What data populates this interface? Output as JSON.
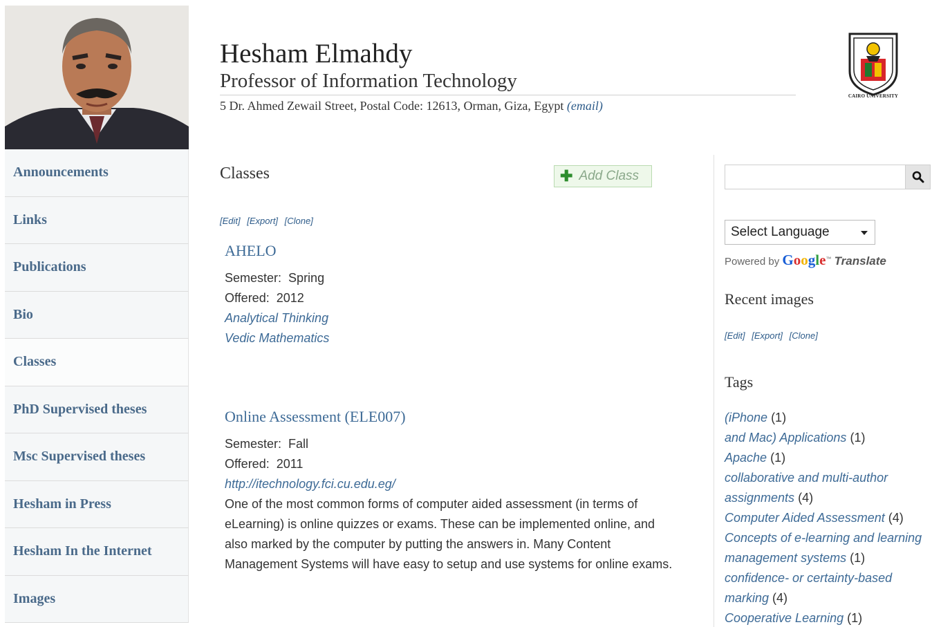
{
  "header": {
    "name": "Hesham Elmahdy",
    "title": "Professor of Information Technology",
    "address": "5 Dr. Ahmed Zewail Street, Postal Code: 12613, Orman, Giza, Egypt",
    "email_label": "(email)"
  },
  "logo": {
    "caption": "CAIRO UNIVERSITY"
  },
  "nav": {
    "items": [
      {
        "label": "Announcements"
      },
      {
        "label": "Links"
      },
      {
        "label": "Publications"
      },
      {
        "label": "Bio"
      },
      {
        "label": "Classes"
      },
      {
        "label": "PhD Supervised theses"
      },
      {
        "label": "Msc Supervised theses"
      },
      {
        "label": "Hesham in Press"
      },
      {
        "label": "Hesham In the Internet"
      },
      {
        "label": "Images"
      }
    ],
    "active_index": 4
  },
  "main": {
    "heading": "Classes",
    "add_class_label": "Add Class",
    "admin_links": {
      "edit": "[Edit]",
      "export": "[Export]",
      "clone": "[Clone]"
    },
    "classes": [
      {
        "title": "AHELO",
        "semester_label": "Semester:",
        "semester": "Spring",
        "offered_label": "Offered:",
        "offered": "2012",
        "links": [
          "Analytical Thinking",
          "Vedic Mathematics"
        ]
      },
      {
        "title": "Online Assessment (ELE007)",
        "semester_label": "Semester:",
        "semester": "Fall",
        "offered_label": "Offered:",
        "offered": "2011",
        "url": "http://itechnology.fci.cu.edu.eg/",
        "description": "One of the most common forms of computer aided assessment (in terms of eLearning) is online quizzes or exams. These can be implemented online, and also marked by the computer by putting the answers in. Many Content Management Systems will have easy to setup and use systems for online exams."
      }
    ]
  },
  "sidebar": {
    "search": {
      "value": "",
      "placeholder": ""
    },
    "language_select": {
      "selected": "Select Language"
    },
    "powered_by": {
      "prefix": "Powered by",
      "google": "Google",
      "tm": "™",
      "translate": "Translate",
      "google_colors": [
        "#1a5fd6",
        "#d92f2f",
        "#f2b400",
        "#1a5fd6",
        "#2f9e3f",
        "#d92f2f"
      ]
    },
    "recent_images_heading": "Recent images",
    "admin_links": {
      "edit": "[Edit]",
      "export": "[Export]",
      "clone": "[Clone]"
    },
    "tags_heading": "Tags",
    "tags": [
      {
        "label": "(iPhone",
        "count": "(1)"
      },
      {
        "label": "and Mac) Applications",
        "count": "(1)"
      },
      {
        "label": "Apache",
        "count": "(1)"
      },
      {
        "label": "collaborative and multi-author assignments",
        "count": "(4)"
      },
      {
        "label": "Computer Aided Assessment",
        "count": "(4)"
      },
      {
        "label": "Concepts of e-learning and learning management systems",
        "count": "(1)"
      },
      {
        "label": "confidence- or certainty-based marking",
        "count": "(4)"
      },
      {
        "label": "Cooperative Learning",
        "count": "(1)"
      }
    ]
  },
  "colors": {
    "link": "#3d6a96",
    "nav_text": "#4a6a8a",
    "add_class_bg": "#eef8ea",
    "add_class_plus": "#2d8c2d"
  }
}
